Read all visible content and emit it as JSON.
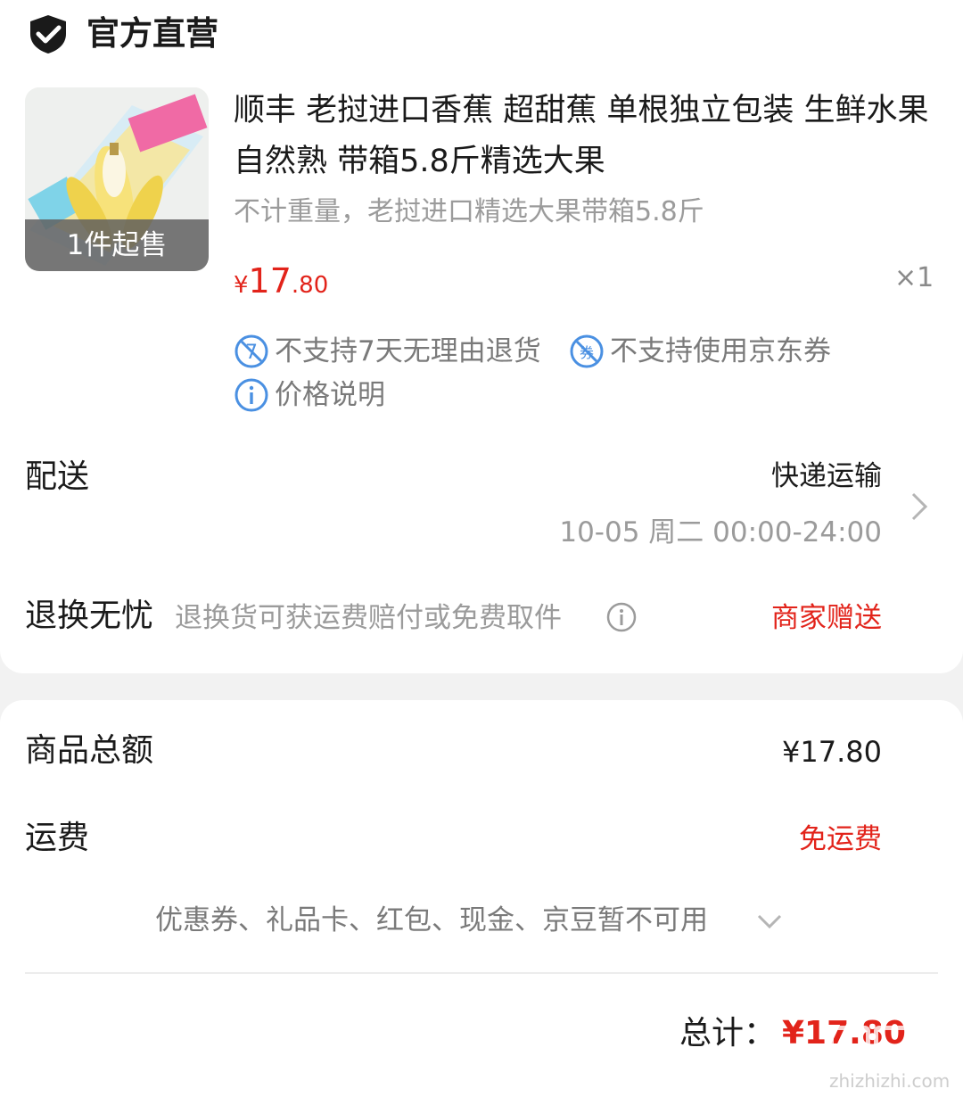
{
  "store": {
    "name": "官方直营",
    "icon": "shield-check-icon"
  },
  "product": {
    "title": "顺丰 老挝进口香蕉 超甜蕉 单根独立包装 生鲜水果自然熟 带箱5.8斤精选大果",
    "spec": "不计重量，老挝进口精选大果带箱5.8斤",
    "min_purchase": "1件起售",
    "price_symbol": "¥",
    "price_int": "17",
    "price_dec": ".80",
    "quantity": "×1",
    "tags": [
      {
        "icon": "no-return-icon",
        "text": "不支持7天无理由退货"
      },
      {
        "icon": "no-coupon-icon",
        "text": "不支持使用京东券"
      },
      {
        "icon": "info-icon",
        "text": "价格说明"
      }
    ]
  },
  "delivery": {
    "label": "配送",
    "method": "快递运输",
    "time": "10-05 周二 00:00-24:00"
  },
  "return_service": {
    "label": "退换无忧",
    "desc": "退换货可获运费赔付或免费取件",
    "value": "商家赠送"
  },
  "summary": {
    "goods_label": "商品总额",
    "goods_amount": "¥17.80",
    "shipping_label": "运费",
    "shipping_value": "免运费",
    "discount_note": "优惠券、礼品卡、红包、现金、京豆暂不可用",
    "total_label": "总计：",
    "total_amount": "¥17.80"
  },
  "watermark": {
    "text": "zhizhizhi.com"
  },
  "colors": {
    "accent_red": "#e2231a",
    "icon_blue": "#4a90e2",
    "text_grey": "#9b9b9b"
  }
}
